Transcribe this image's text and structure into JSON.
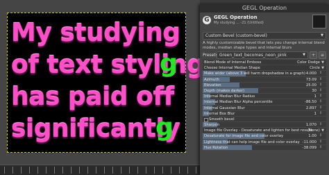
{
  "canvas": {
    "lines": [
      {
        "text": "My studying",
        "green": ""
      },
      {
        "text": "of text styling",
        "green": ""
      },
      {
        "text": "has paid off",
        "green": ""
      },
      {
        "text": "significantly",
        "green": ""
      }
    ],
    "side_letter_1": "g",
    "side_letter_2": "ng",
    "side_letter_3": "g"
  },
  "dialog": {
    "window_title": "GEGL Operation",
    "op_title": "GEGL Operation",
    "op_subtitle": "My studying ... -21 (Untitled)",
    "op_combo": "Custom Bevel (custom-bevel)",
    "description": "A highly customizable bevel that lets you change internal blend modes, median shape types and internal blurs",
    "presets_label": "Presets:",
    "presets_value": "Green_text_becomes_neon_pink",
    "presets_btn_add": "+",
    "presets_btn_menu": "≡"
  },
  "rows": [
    {
      "label": "Blend Mode of Internal Emboss",
      "value": "Color Dodge",
      "type": "dropdown"
    },
    {
      "label": "Choose Internal Median Shape",
      "value": "Circle",
      "type": "dropdown"
    },
    {
      "label": "Make wider (above 3 will harm dropshadow in a graph)",
      "value": "4.000",
      "type": "slider",
      "fill": 0.35
    },
    {
      "label": "Azimuth",
      "value": "73.09",
      "type": "slider",
      "fill": 0.22
    },
    {
      "label": "Elevation",
      "value": "25.00",
      "type": "slider",
      "fill": 0.3
    },
    {
      "label": "Depth (makes darker)",
      "value": "30",
      "type": "slider",
      "fill": 0.45
    },
    {
      "label": "Internal Median Blur Radius",
      "value": "1",
      "type": "slider",
      "fill": 0.06
    },
    {
      "label": "Internal Median Blur Alpha percentile",
      "value": "-86.50",
      "type": "slider",
      "fill": 0.1
    },
    {
      "label": "Internal Gaussian Blur",
      "value": "2.897",
      "type": "slider",
      "fill": 0.08
    },
    {
      "label": "Internal Box Blur",
      "value": "1",
      "type": "slider",
      "fill": 0.05
    },
    {
      "label": "Smooth bevel",
      "value": "",
      "type": "check"
    },
    {
      "label": "Sharpen",
      "value": "1.070",
      "type": "slider",
      "fill": 0.12
    },
    {
      "label": "Image file Overlay - Desaturate and lighten for best results",
      "value": "(None)",
      "type": "dropdown"
    },
    {
      "label": "Desaturate for image file and color overlay",
      "value": "1.00",
      "type": "slider",
      "fill": 0.5
    },
    {
      "label": "Lightness that can help image file and color overlay",
      "value": "-11.000",
      "type": "slider",
      "fill": 0.2
    },
    {
      "label": "Hue Rotation",
      "value": "-38.099",
      "type": "slider",
      "fill": 0.4
    }
  ],
  "colors": {
    "text_pink": "#ff4fc8",
    "text_green": "#27e527",
    "accent": "#5b6e84"
  }
}
